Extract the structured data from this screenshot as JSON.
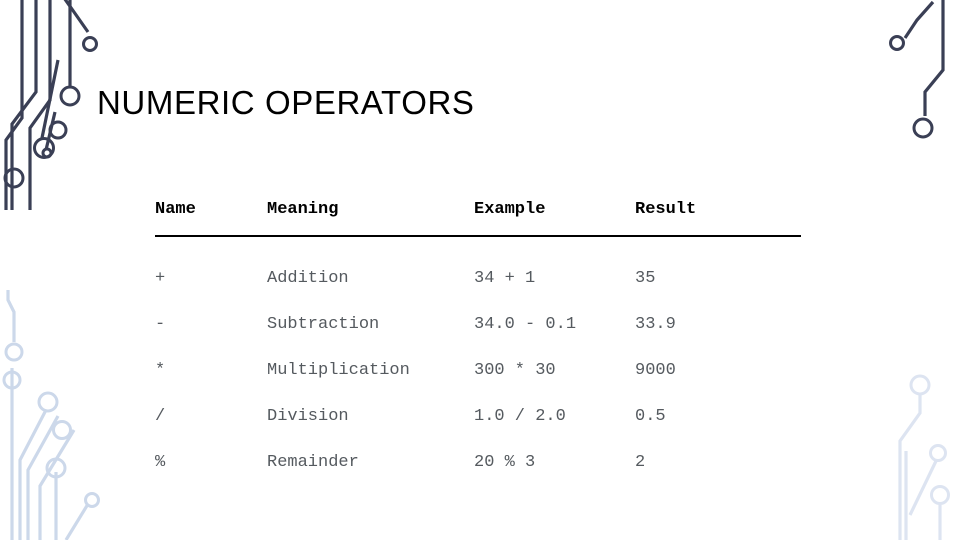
{
  "slide": {
    "title": "NUMERIC OPERATORS",
    "background_color": "#ffffff",
    "title_color": "#000000",
    "body_text_color": "#555a5f",
    "header_text_color": "#000000",
    "rule_color": "#000000",
    "decor_dark_color": "#3a3f55",
    "decor_light_color": "#ccd8ea"
  },
  "table": {
    "columns": [
      {
        "key": "name",
        "label": "Name"
      },
      {
        "key": "meaning",
        "label": "Meaning"
      },
      {
        "key": "example",
        "label": "Example"
      },
      {
        "key": "result",
        "label": "Result"
      }
    ],
    "rows": [
      {
        "name": "+",
        "meaning": "Addition",
        "example": "34 + 1",
        "result": "35"
      },
      {
        "name": "-",
        "meaning": "Subtraction",
        "example": "34.0 - 0.1",
        "result": "33.9"
      },
      {
        "name": "*",
        "meaning": "Multiplication",
        "example": "300 * 30",
        "result": "9000"
      },
      {
        "name": "/",
        "meaning": "Division",
        "example": "1.0 / 2.0",
        "result": "0.5"
      },
      {
        "name": "%",
        "meaning": "Remainder",
        "example": "20 % 3",
        "result": "2"
      }
    ]
  },
  "decorations": [
    {
      "name": "circuit-top-left",
      "tone": "dark"
    },
    {
      "name": "circuit-bottom-left",
      "tone": "light"
    },
    {
      "name": "circuit-top-right",
      "tone": "dark"
    },
    {
      "name": "circuit-bottom-right",
      "tone": "light"
    }
  ]
}
